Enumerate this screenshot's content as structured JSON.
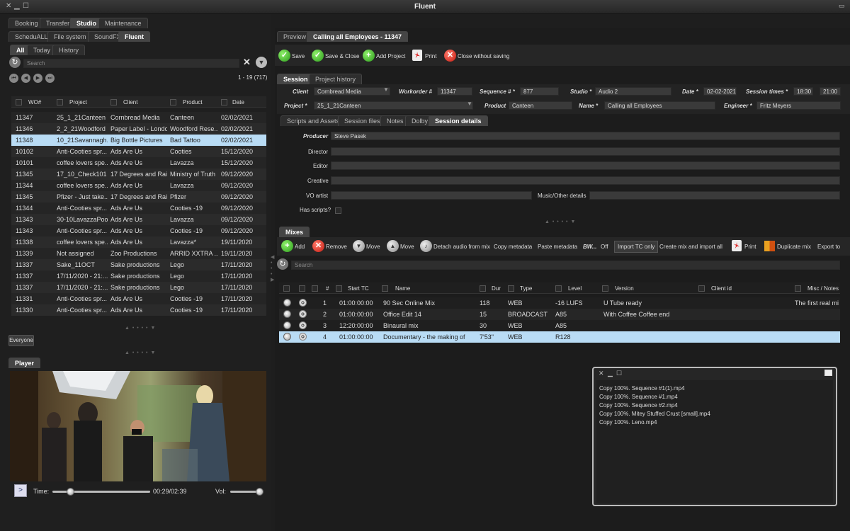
{
  "window": {
    "title": "Fluent"
  },
  "top_tabs": [
    "Booking",
    "Transfer",
    "Studio",
    "Maintenance"
  ],
  "sub_tabs": [
    "ScheduALL",
    "File system",
    "SoundFX",
    "Fluent"
  ],
  "filter_tabs": [
    "All",
    "Today",
    "History"
  ],
  "search": {
    "placeholder": "Search",
    "count": "1 - 19 (717)"
  },
  "list": {
    "headers": [
      "WO#",
      "Project",
      "Client",
      "Product",
      "Date"
    ],
    "rows": [
      [
        "11347",
        "25_1_21Canteen",
        "Cornbread Media",
        "Canteen",
        "02/02/2021"
      ],
      [
        "11346",
        "2_2_21Woodford",
        "Paper Label - London",
        "Woodford Rese...",
        "02/02/2021"
      ],
      [
        "11348",
        "10_21Savannagh...",
        "Big Bottle Pictures",
        "Bad Tattoo",
        "02/02/2021"
      ],
      [
        "10102",
        "Anti-Cooties spr...",
        "Ads Are Us",
        "Cooties",
        "15/12/2020"
      ],
      [
        "10101",
        "coffee lovers spe...",
        "Ads Are Us",
        "Lavazza",
        "15/12/2020"
      ],
      [
        "11345",
        "17_10_Check101",
        "17 Degrees and Rai...",
        "Ministry of Truth",
        "09/12/2020"
      ],
      [
        "11344",
        "coffee lovers spe...",
        "Ads Are Us",
        "Lavazza",
        "09/12/2020"
      ],
      [
        "11345",
        "Pfizer - Just take...",
        "17 Degrees and Rai...",
        "Pfizer",
        "09/12/2020"
      ],
      [
        "11344",
        "Anti-Cooties spr...",
        "Ads Are Us",
        "Cooties -19",
        "09/12/2020"
      ],
      [
        "11343",
        "30-10LavazzaPoo",
        "Ads Are Us",
        "Lavazza",
        "09/12/2020"
      ],
      [
        "11343",
        "Anti-Cooties spr...",
        "Ads Are Us",
        "Cooties -19",
        "09/12/2020"
      ],
      [
        "11338",
        "coffee lovers spe...",
        "Ads Are Us",
        "Lavazza*",
        "19/11/2020"
      ],
      [
        "11339",
        "Not assigned",
        "Zoo Productions",
        "ARRID XXTRA ...",
        "19/11/2020"
      ],
      [
        "11337",
        "Sake_11OCT",
        "Sake productions",
        "Lego",
        "17/11/2020"
      ],
      [
        "11337",
        "17/11/2020 - 21:...",
        "Sake productions",
        "Lego",
        "17/11/2020"
      ],
      [
        "11337",
        "17/11/2020 - 21:...",
        "Sake productions",
        "Lego",
        "17/11/2020"
      ],
      [
        "11331",
        "Anti-Cooties spr...",
        "Ads Are Us",
        "Cooties -19",
        "17/11/2020"
      ],
      [
        "11330",
        "Anti-Cooties spr...",
        "Ads Are Us",
        "Cooties -19",
        "17/11/2020"
      ]
    ]
  },
  "everyone_button": "Everyone",
  "player": {
    "tab": "Player",
    "time_label": "Time:",
    "time_value": "00:29/02:39",
    "vol_label": "Vol:",
    "play_symbol": ">",
    "progress": 0.18,
    "volume": 0.95
  },
  "right_tabs": [
    "Preview",
    "Calling all Employees - 11347"
  ],
  "toolbar": [
    "Save",
    "Save & Close",
    "Add Project",
    "Print",
    "Close without saving"
  ],
  "session_tabs": [
    "Session",
    "Project history"
  ],
  "session": {
    "client_label": "Client",
    "client": "Cornbread Media",
    "workorder_label": "Workorder #",
    "workorder": "11347",
    "sequence_label": "Sequence # *",
    "sequence": "877",
    "studio_label": "Studio *",
    "studio": "Audio 2",
    "date_label": "Date *",
    "date": "02-02-2021",
    "times_label": "Session times *",
    "time_start": "18:30",
    "time_end": "21:00",
    "project_label": "Project *",
    "project": "25_1_21Canteen",
    "product_label": "Product",
    "product": "Canteen",
    "name_label": "Name *",
    "name": "Calling all Employees",
    "engineer_label": "Engineer *",
    "engineer": "Fritz Meyers"
  },
  "detail_tabs": [
    "Scripts and Assets",
    "Session files",
    "Notes",
    "Dolby",
    "Session details"
  ],
  "details": {
    "producer_label": "Producer",
    "producer": "Steve Pasek",
    "director_label": "Director",
    "editor_label": "Editor",
    "creative_label": "Creative",
    "vo_label": "VO artist",
    "music_label": "Music/Other details",
    "scripts_label": "Has scripts?"
  },
  "mixes": {
    "tab": "Mixes",
    "toolbar": [
      "Add",
      "Remove",
      "Move",
      "Move",
      "Detach audio from mix",
      "Copy metadata",
      "Paste metadata",
      "BW...",
      "Off",
      "Import TC only",
      "Create mix and import all",
      "Print",
      "Duplicate mix",
      "Export to"
    ],
    "search_placeholder": "Search",
    "headers": [
      "#",
      "Start TC",
      "Name",
      "Dur",
      "Type",
      "Level",
      "Version",
      "Client id",
      "Misc / Notes"
    ],
    "rows": [
      [
        "1",
        "01:00:00:00",
        "90 Sec Online Mix",
        "118",
        "WEB",
        "-16 LUFS",
        "U Tube ready",
        "",
        "The first real mix"
      ],
      [
        "2",
        "01:00:00:00",
        "Office Edit 14",
        "15",
        "BROADCAST",
        "A85",
        "With Coffee Coffee end",
        "",
        ""
      ],
      [
        "3",
        "12:20:00:00",
        "Binaural mix",
        "30",
        "WEB",
        "A85",
        "",
        "",
        ""
      ],
      [
        "4",
        "01:00:00:00",
        "Documentary - the making of",
        "7'53\"",
        "WEB",
        "R128",
        "",
        "",
        ""
      ]
    ]
  },
  "log": {
    "lines": [
      "Copy 100%. Sequence #1(1).mp4",
      "Copy 100%. Sequence #1.mp4",
      "Copy 100%. Sequence #2.mp4",
      "Copy 100%. Mitey Stuffed Crust [small].mp4",
      "Copy 100%. Leno.mp4"
    ]
  }
}
